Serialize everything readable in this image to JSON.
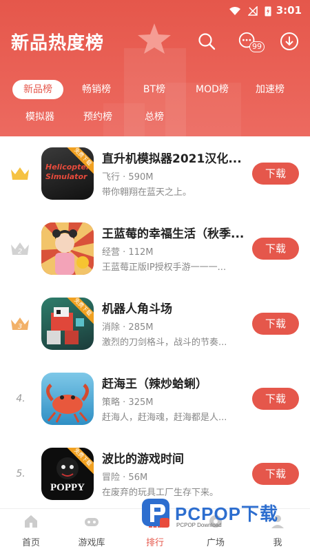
{
  "status": {
    "time": "3:01"
  },
  "header": {
    "title": "新品热度榜"
  },
  "tabs_row1": [
    {
      "label": "新品榜",
      "active": true
    },
    {
      "label": "畅销榜"
    },
    {
      "label": "BT榜"
    },
    {
      "label": "MOD榜"
    },
    {
      "label": "加速榜"
    }
  ],
  "tabs_row2": [
    {
      "label": "模拟器"
    },
    {
      "label": "预约榜"
    },
    {
      "label": "总榜"
    }
  ],
  "badge": {
    "count": "99"
  },
  "apps": [
    {
      "rank": "1",
      "name": "直升机模拟器2021汉化...",
      "category": "飞行",
      "size": "590M",
      "desc": "带你翱翔在蓝天之上。",
      "button": "下载",
      "icon_text": "Helicopter Simulator",
      "ribbon": "免费下载"
    },
    {
      "rank": "2",
      "name": "王蓝莓的幸福生活（秋季...",
      "category": "经营",
      "size": "112M",
      "desc": "王蓝莓正版IP授权手游一一一...",
      "button": "下载"
    },
    {
      "rank": "3",
      "name": "机器人角斗场",
      "category": "消除",
      "size": "285M",
      "desc": "激烈的刀剑格斗，战斗的节奏...",
      "button": "下载",
      "ribbon": "免费下载"
    },
    {
      "rank": "4.",
      "name": "赶海王（辣炒蛤蜊）",
      "category": "策略",
      "size": "325M",
      "desc": "赶海人，赶海魂，赶海都是人...",
      "button": "下载"
    },
    {
      "rank": "5.",
      "name": "波比的游戏时间",
      "category": "冒险",
      "size": "56M",
      "desc": "在废弃的玩具工厂生存下来。",
      "button": "下载",
      "icon_text": "POPPY",
      "ribbon": "免费下载"
    }
  ],
  "nav": [
    {
      "label": "首页"
    },
    {
      "label": "游戏库"
    },
    {
      "label": "排行",
      "active": true
    },
    {
      "label": "广场"
    },
    {
      "label": "我"
    }
  ],
  "watermark": {
    "text": "PCPOP下载",
    "sub": "PCPOP Download"
  },
  "colors": {
    "accent": "#e5574b",
    "header_bg": "#ea6257"
  }
}
